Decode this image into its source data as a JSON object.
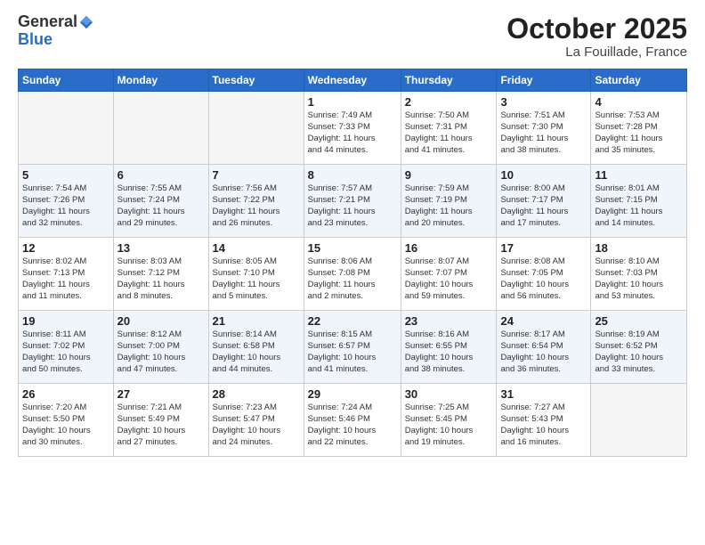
{
  "header": {
    "logo_general": "General",
    "logo_blue": "Blue",
    "month": "October 2025",
    "location": "La Fouillade, France"
  },
  "days_of_week": [
    "Sunday",
    "Monday",
    "Tuesday",
    "Wednesday",
    "Thursday",
    "Friday",
    "Saturday"
  ],
  "weeks": [
    [
      {
        "day": "",
        "info": ""
      },
      {
        "day": "",
        "info": ""
      },
      {
        "day": "",
        "info": ""
      },
      {
        "day": "1",
        "info": "Sunrise: 7:49 AM\nSunset: 7:33 PM\nDaylight: 11 hours\nand 44 minutes."
      },
      {
        "day": "2",
        "info": "Sunrise: 7:50 AM\nSunset: 7:31 PM\nDaylight: 11 hours\nand 41 minutes."
      },
      {
        "day": "3",
        "info": "Sunrise: 7:51 AM\nSunset: 7:30 PM\nDaylight: 11 hours\nand 38 minutes."
      },
      {
        "day": "4",
        "info": "Sunrise: 7:53 AM\nSunset: 7:28 PM\nDaylight: 11 hours\nand 35 minutes."
      }
    ],
    [
      {
        "day": "5",
        "info": "Sunrise: 7:54 AM\nSunset: 7:26 PM\nDaylight: 11 hours\nand 32 minutes."
      },
      {
        "day": "6",
        "info": "Sunrise: 7:55 AM\nSunset: 7:24 PM\nDaylight: 11 hours\nand 29 minutes."
      },
      {
        "day": "7",
        "info": "Sunrise: 7:56 AM\nSunset: 7:22 PM\nDaylight: 11 hours\nand 26 minutes."
      },
      {
        "day": "8",
        "info": "Sunrise: 7:57 AM\nSunset: 7:21 PM\nDaylight: 11 hours\nand 23 minutes."
      },
      {
        "day": "9",
        "info": "Sunrise: 7:59 AM\nSunset: 7:19 PM\nDaylight: 11 hours\nand 20 minutes."
      },
      {
        "day": "10",
        "info": "Sunrise: 8:00 AM\nSunset: 7:17 PM\nDaylight: 11 hours\nand 17 minutes."
      },
      {
        "day": "11",
        "info": "Sunrise: 8:01 AM\nSunset: 7:15 PM\nDaylight: 11 hours\nand 14 minutes."
      }
    ],
    [
      {
        "day": "12",
        "info": "Sunrise: 8:02 AM\nSunset: 7:13 PM\nDaylight: 11 hours\nand 11 minutes."
      },
      {
        "day": "13",
        "info": "Sunrise: 8:03 AM\nSunset: 7:12 PM\nDaylight: 11 hours\nand 8 minutes."
      },
      {
        "day": "14",
        "info": "Sunrise: 8:05 AM\nSunset: 7:10 PM\nDaylight: 11 hours\nand 5 minutes."
      },
      {
        "day": "15",
        "info": "Sunrise: 8:06 AM\nSunset: 7:08 PM\nDaylight: 11 hours\nand 2 minutes."
      },
      {
        "day": "16",
        "info": "Sunrise: 8:07 AM\nSunset: 7:07 PM\nDaylight: 10 hours\nand 59 minutes."
      },
      {
        "day": "17",
        "info": "Sunrise: 8:08 AM\nSunset: 7:05 PM\nDaylight: 10 hours\nand 56 minutes."
      },
      {
        "day": "18",
        "info": "Sunrise: 8:10 AM\nSunset: 7:03 PM\nDaylight: 10 hours\nand 53 minutes."
      }
    ],
    [
      {
        "day": "19",
        "info": "Sunrise: 8:11 AM\nSunset: 7:02 PM\nDaylight: 10 hours\nand 50 minutes."
      },
      {
        "day": "20",
        "info": "Sunrise: 8:12 AM\nSunset: 7:00 PM\nDaylight: 10 hours\nand 47 minutes."
      },
      {
        "day": "21",
        "info": "Sunrise: 8:14 AM\nSunset: 6:58 PM\nDaylight: 10 hours\nand 44 minutes."
      },
      {
        "day": "22",
        "info": "Sunrise: 8:15 AM\nSunset: 6:57 PM\nDaylight: 10 hours\nand 41 minutes."
      },
      {
        "day": "23",
        "info": "Sunrise: 8:16 AM\nSunset: 6:55 PM\nDaylight: 10 hours\nand 38 minutes."
      },
      {
        "day": "24",
        "info": "Sunrise: 8:17 AM\nSunset: 6:54 PM\nDaylight: 10 hours\nand 36 minutes."
      },
      {
        "day": "25",
        "info": "Sunrise: 8:19 AM\nSunset: 6:52 PM\nDaylight: 10 hours\nand 33 minutes."
      }
    ],
    [
      {
        "day": "26",
        "info": "Sunrise: 7:20 AM\nSunset: 5:50 PM\nDaylight: 10 hours\nand 30 minutes."
      },
      {
        "day": "27",
        "info": "Sunrise: 7:21 AM\nSunset: 5:49 PM\nDaylight: 10 hours\nand 27 minutes."
      },
      {
        "day": "28",
        "info": "Sunrise: 7:23 AM\nSunset: 5:47 PM\nDaylight: 10 hours\nand 24 minutes."
      },
      {
        "day": "29",
        "info": "Sunrise: 7:24 AM\nSunset: 5:46 PM\nDaylight: 10 hours\nand 22 minutes."
      },
      {
        "day": "30",
        "info": "Sunrise: 7:25 AM\nSunset: 5:45 PM\nDaylight: 10 hours\nand 19 minutes."
      },
      {
        "day": "31",
        "info": "Sunrise: 7:27 AM\nSunset: 5:43 PM\nDaylight: 10 hours\nand 16 minutes."
      },
      {
        "day": "",
        "info": ""
      }
    ]
  ]
}
